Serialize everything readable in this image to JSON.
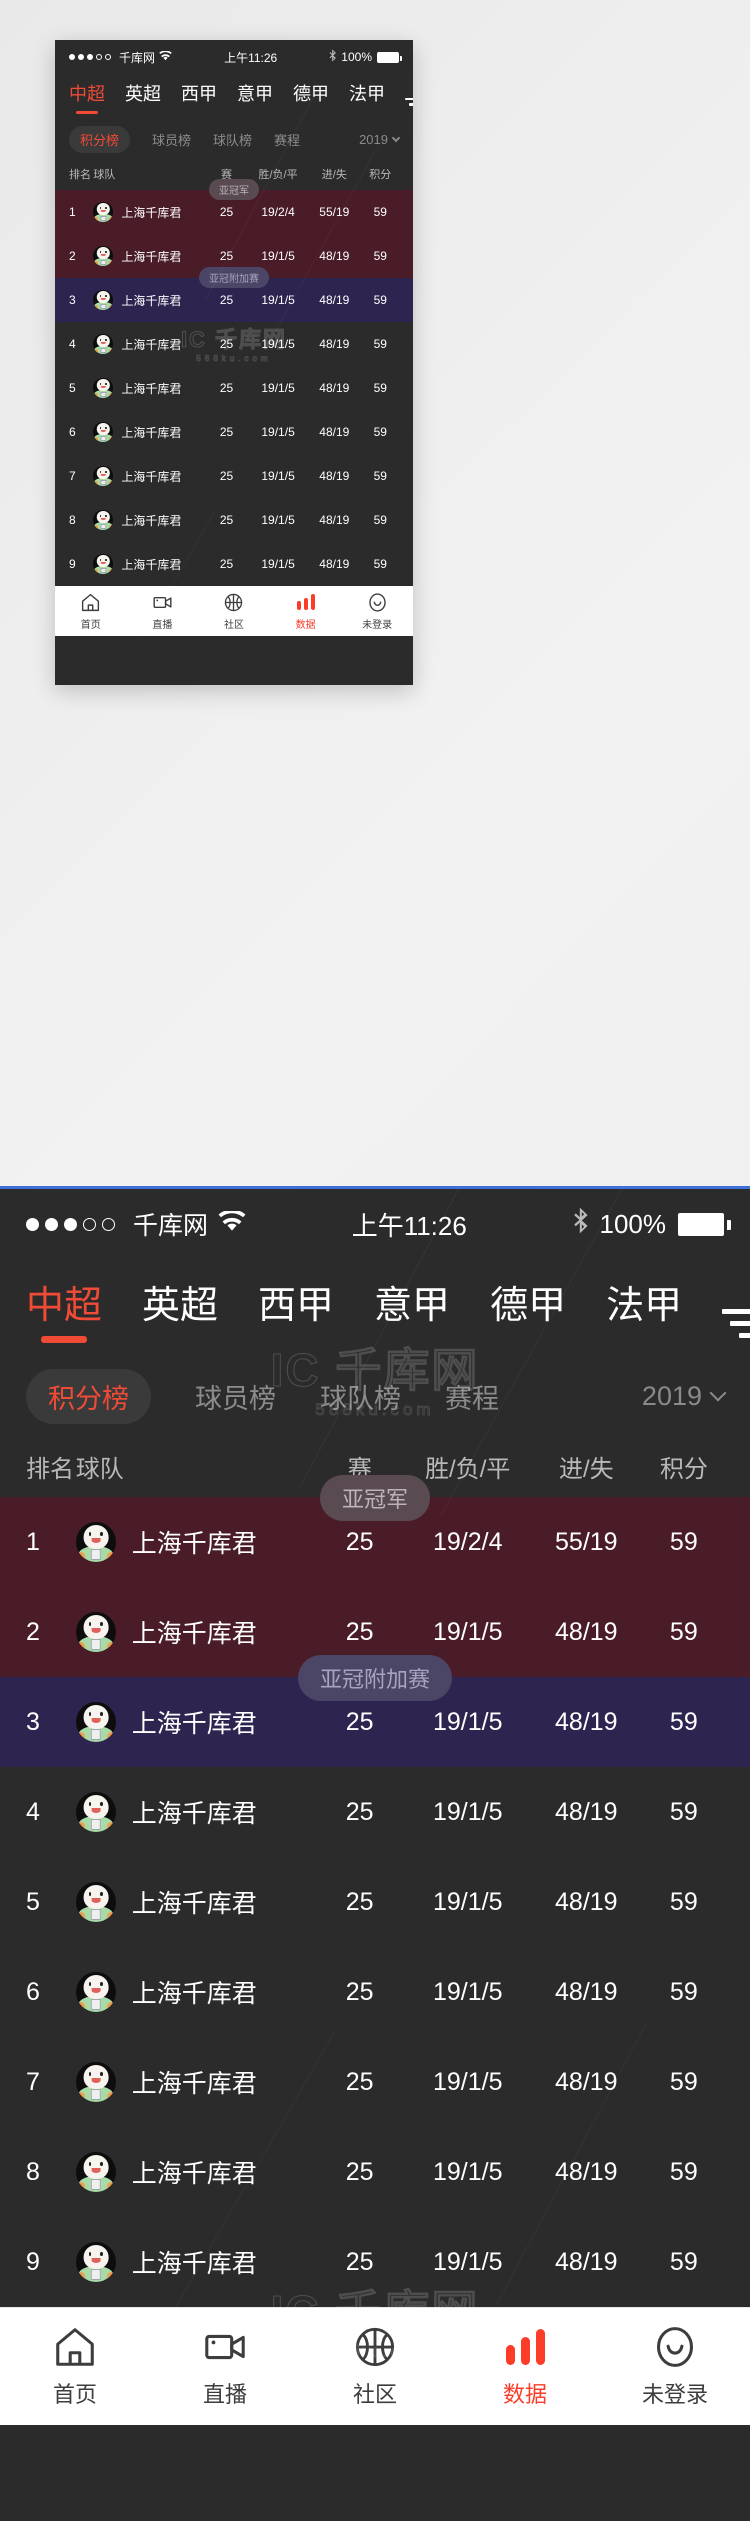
{
  "status_bar": {
    "signal_dots_filled": 3,
    "signal_dots_total": 5,
    "carrier": "千库网",
    "wifi_icon": "wifi-icon",
    "time": "上午11:26",
    "bluetooth_icon": "bluetooth-icon",
    "battery_percent": "100%"
  },
  "league_tabs": [
    {
      "label": "中超",
      "active": true
    },
    {
      "label": "英超",
      "active": false
    },
    {
      "label": "西甲",
      "active": false
    },
    {
      "label": "意甲",
      "active": false
    },
    {
      "label": "德甲",
      "active": false
    },
    {
      "label": "法甲",
      "active": false
    }
  ],
  "filter_icon": "sort-filter-icon",
  "sub_tabs": [
    {
      "label": "积分榜",
      "active": true
    },
    {
      "label": "球员榜",
      "active": false
    },
    {
      "label": "球队榜",
      "active": false
    },
    {
      "label": "赛程",
      "active": false
    }
  ],
  "season_select": {
    "value": "2019",
    "chevron_icon": "chevron-down-icon"
  },
  "table": {
    "headers": {
      "rank": "排名",
      "team": "球队",
      "played": "赛",
      "wdl": "胜/负/平",
      "goals": "进/失",
      "points": "积分"
    },
    "zone_badges": {
      "champions": "亚冠军",
      "playoff": "亚冠附加赛"
    },
    "rows": [
      {
        "rank": "1",
        "team": "上海千库君",
        "played": "25",
        "wdl": "19/2/4",
        "goals": "55/19",
        "points": "59",
        "zone": "maroon"
      },
      {
        "rank": "2",
        "team": "上海千库君",
        "played": "25",
        "wdl": "19/1/5",
        "goals": "48/19",
        "points": "59",
        "zone": "maroon"
      },
      {
        "rank": "3",
        "team": "上海千库君",
        "played": "25",
        "wdl": "19/1/5",
        "goals": "48/19",
        "points": "59",
        "zone": "purple"
      },
      {
        "rank": "4",
        "team": "上海千库君",
        "played": "25",
        "wdl": "19/1/5",
        "goals": "48/19",
        "points": "59",
        "zone": "plain"
      },
      {
        "rank": "5",
        "team": "上海千库君",
        "played": "25",
        "wdl": "19/1/5",
        "goals": "48/19",
        "points": "59",
        "zone": "plain"
      },
      {
        "rank": "6",
        "team": "上海千库君",
        "played": "25",
        "wdl": "19/1/5",
        "goals": "48/19",
        "points": "59",
        "zone": "plain"
      },
      {
        "rank": "7",
        "team": "上海千库君",
        "played": "25",
        "wdl": "19/1/5",
        "goals": "48/19",
        "points": "59",
        "zone": "plain"
      },
      {
        "rank": "8",
        "team": "上海千库君",
        "played": "25",
        "wdl": "19/1/5",
        "goals": "48/19",
        "points": "59",
        "zone": "plain"
      },
      {
        "rank": "9",
        "team": "上海千库君",
        "played": "25",
        "wdl": "19/1/5",
        "goals": "48/19",
        "points": "59",
        "zone": "plain"
      }
    ]
  },
  "bottom_nav": [
    {
      "label": "首页",
      "icon": "home-icon",
      "active": false
    },
    {
      "label": "直播",
      "icon": "video-icon",
      "active": false
    },
    {
      "label": "社区",
      "icon": "basketball-icon",
      "active": false
    },
    {
      "label": "数据",
      "icon": "bar-chart-icon",
      "active": true
    },
    {
      "label": "未登录",
      "icon": "smiley-icon",
      "active": false
    }
  ],
  "watermark": {
    "logo": "IC",
    "text": "千库网",
    "url": "588ku.com"
  },
  "colors": {
    "accent": "#f04b37",
    "nav_active": "#fa3c28",
    "screen_bg": "#2b2b2b",
    "zone_champions": "#4a1c27",
    "zone_playoff": "#2e2450"
  }
}
